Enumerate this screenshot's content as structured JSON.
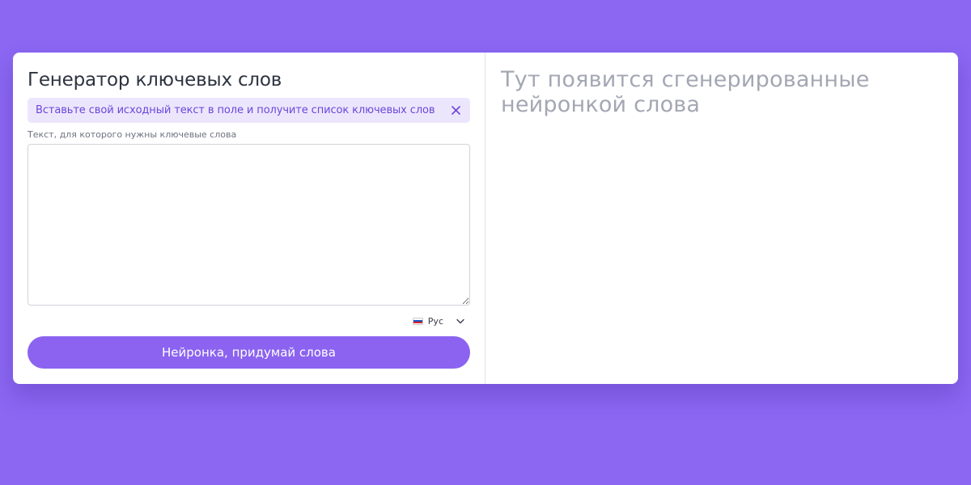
{
  "generator": {
    "title": "Генератор ключевых слов",
    "alert_text": "Вставьте свой исходный текст в поле и получите список ключевых слов",
    "field_label": "Текст, для которого нужны ключевые слова",
    "textarea_value": "",
    "language": {
      "flag_icon": "russia-flag-icon",
      "selected": "Рус"
    },
    "submit_label": "Нейронка, придумай слова"
  },
  "output": {
    "placeholder": "Тут появится сгенерированные нейронкой слова"
  },
  "colors": {
    "background": "#8b67f2",
    "accent": "#8b63f0",
    "alert_bg": "#ece6fd",
    "alert_text": "#6b46d9",
    "placeholder_text": "#a3a7b3"
  }
}
